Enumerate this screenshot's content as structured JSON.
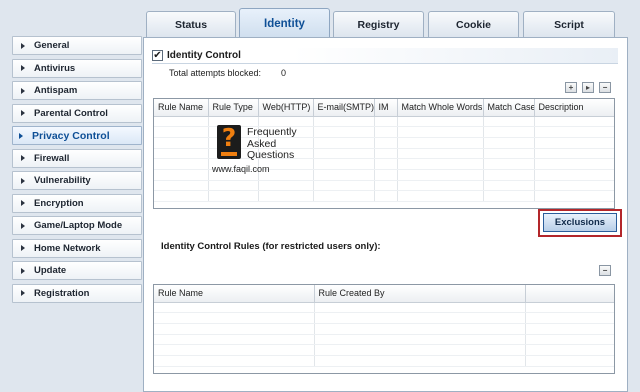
{
  "sidebar": {
    "items": [
      {
        "label": "General",
        "active": false
      },
      {
        "label": "Antivirus",
        "active": false
      },
      {
        "label": "Antispam",
        "active": false
      },
      {
        "label": "Parental Control",
        "active": false
      },
      {
        "label": "Privacy Control",
        "active": true
      },
      {
        "label": "Firewall",
        "active": false
      },
      {
        "label": "Vulnerability",
        "active": false
      },
      {
        "label": "Encryption",
        "active": false
      },
      {
        "label": "Game/Laptop Mode",
        "active": false
      },
      {
        "label": "Home Network",
        "active": false
      },
      {
        "label": "Update",
        "active": false
      },
      {
        "label": "Registration",
        "active": false
      }
    ]
  },
  "tabs": [
    {
      "label": "Status",
      "active": false
    },
    {
      "label": "Identity",
      "active": true
    },
    {
      "label": "Registry",
      "active": false
    },
    {
      "label": "Cookie",
      "active": false
    },
    {
      "label": "Script",
      "active": false
    }
  ],
  "identity": {
    "checkbox_checked": true,
    "checkbox_mark": "✔",
    "title": "Identity Control",
    "attempts_label": "Total attempts blocked:",
    "attempts_value": "0",
    "toolbar_icons": [
      "add-icon",
      "edit-icon",
      "remove-icon"
    ],
    "columns": [
      "Rule Name",
      "Rule Type",
      "Web(HTTP)",
      "E-mail(SMTP)",
      "IM",
      "Match Whole Words",
      "Match Case",
      "Description"
    ]
  },
  "watermark": {
    "glyph": "?",
    "line1": "Frequently",
    "line2": "Asked",
    "line3": "Questions",
    "url": "www.faqil.com"
  },
  "exclusions_label": "Exclusions",
  "rules": {
    "title": "Identity Control Rules (for restricted users only):",
    "toolbar_icons": [
      "remove-icon"
    ],
    "columns": [
      "Rule Name",
      "Rule Created By",
      ""
    ]
  },
  "colors": {
    "accent": "#0e4f96",
    "highlight": "#b3262a",
    "watermark_orange": "#f07f10"
  }
}
